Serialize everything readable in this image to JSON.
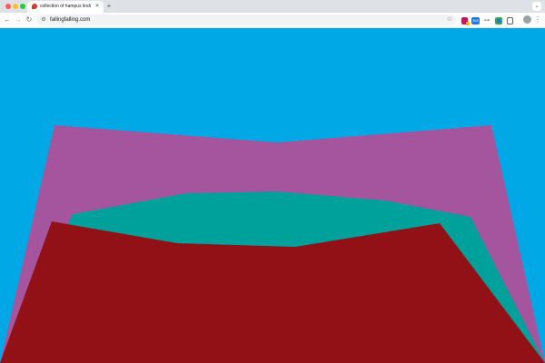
{
  "browser": {
    "tab": {
      "title": "collection of hampus lindwall",
      "close_glyph": "✕"
    },
    "new_tab_glyph": "+",
    "tab_menu_glyph": "⌄",
    "nav": {
      "back_glyph": "←",
      "forward_glyph": "→",
      "reload_glyph": "↻"
    },
    "site_info_glyph": "⚙",
    "url": "fallingfalling.com",
    "bookmark_glyph": "☆",
    "extensions": {
      "badge_label": "365",
      "tool_glyph": "⊶"
    },
    "menu_glyph": "⋮"
  },
  "colors": {
    "traffic_red": "#ff5f57",
    "traffic_yellow": "#febc2e",
    "traffic_green": "#28c840",
    "sky": "#00a9e6",
    "purple": "#a4559d",
    "teal": "#00a19a",
    "red": "#921117"
  },
  "icons": [
    "close-icon",
    "plus-icon",
    "chevron-down-icon",
    "back-arrow-icon",
    "forward-arrow-icon",
    "reload-icon",
    "site-info-icon",
    "star-icon",
    "kebab-menu-icon"
  ]
}
